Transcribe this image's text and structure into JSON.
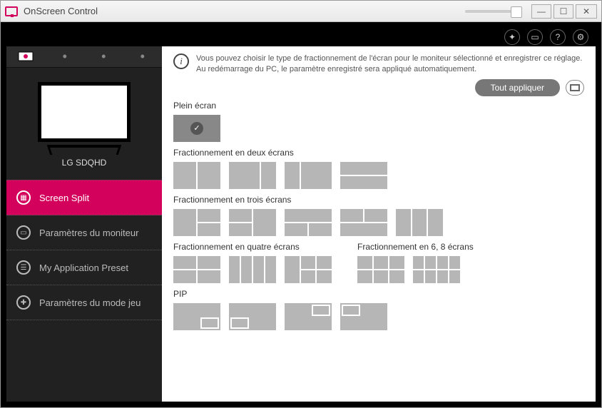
{
  "window": {
    "title": "OnScreen Control",
    "minimize": "—",
    "maximize": "☐",
    "close": "✕"
  },
  "toolbar": {
    "icons": [
      "pointer-icon",
      "monitor-icon",
      "help-icon",
      "gear-icon"
    ]
  },
  "sidebar": {
    "monitor_name": "LG SDQHD",
    "items": [
      {
        "label": "Screen Split"
      },
      {
        "label": "Paramètres du moniteur"
      },
      {
        "label": "My Application Preset"
      },
      {
        "label": "Paramètres du mode jeu"
      }
    ]
  },
  "info": {
    "text": "Vous pouvez choisir le type de fractionnement de l'écran pour le moniteur sélectionné et enregistrer ce réglage. Au redémarrage du PC, le paramètre enregistré sera appliqué automatiquement."
  },
  "actions": {
    "apply_all": "Tout appliquer"
  },
  "sections": {
    "full": "Plein écran",
    "two": "Fractionnement en deux écrans",
    "three": "Fractionnement en trois écrans",
    "four": "Fractionnement en quatre écrans",
    "sixeight": "Fractionnement en 6, 8 écrans",
    "pip": "PIP"
  }
}
